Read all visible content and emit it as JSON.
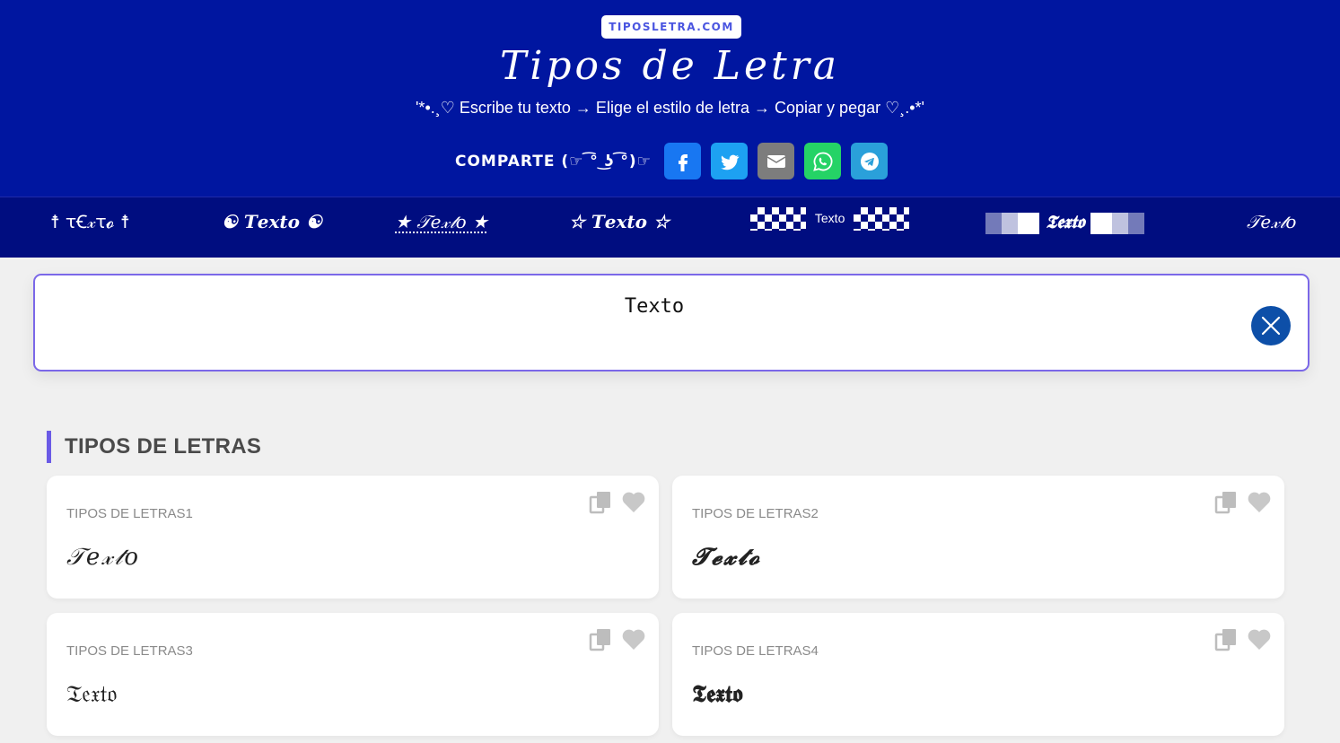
{
  "header": {
    "site_badge": "TIPOSLETRA.COM",
    "title": "Tipos de Letra",
    "subtitle": "'*•.¸♡ Escribe tu texto → Elige el estilo de letra → Copiar y pegar ♡¸.•*'",
    "share_label": "COMPARTE (☞ ͡° ͜ʖ ͡°)☞",
    "share_buttons": [
      {
        "icon": "facebook-icon",
        "color": "#1877f2"
      },
      {
        "icon": "twitter-icon",
        "color": "#1da1f2"
      },
      {
        "icon": "email-icon",
        "color": "#7d7d7d"
      },
      {
        "icon": "whatsapp-icon",
        "color": "#25d366"
      },
      {
        "icon": "telegram-icon",
        "color": "#2aa0da"
      }
    ]
  },
  "style_strip": [
    "☨ ꚍꞒ𝓍ꚍ𝓸 ☨",
    "☯ 𝑻𝒆𝒙𝒕𝒐 ☯",
    "★ 𝒯𝑒𝓍𝓉𝑜 ★",
    "☆ 𝑻𝒆𝒙𝒕𝒐 ☆",
    "Texto",
    "𝕿𝖊𝖝𝖙𝖔",
    "𝒯𝑒𝓍𝓉𝑜"
  ],
  "input": {
    "value": "Texto"
  },
  "section": {
    "title": "TIPOS DE LETRAS"
  },
  "cards": [
    {
      "label": "TIPOS DE LETRAS1",
      "sample": "𝒯𝑒𝓍𝓉𝑜"
    },
    {
      "label": "TIPOS DE LETRAS2",
      "sample": "𝓣𝓮𝔁𝓽𝓸"
    },
    {
      "label": "TIPOS DE LETRAS3",
      "sample": "𝔗𝔢𝔵𝔱𝔬"
    },
    {
      "label": "TIPOS DE LETRAS4",
      "sample": "𝕿𝖊𝖝𝖙𝖔"
    }
  ],
  "colors": {
    "header_bg": "#0016a0",
    "strip_bg": "#000d80",
    "accent": "#7b68e8",
    "clear_button": "#0d4fa8"
  }
}
